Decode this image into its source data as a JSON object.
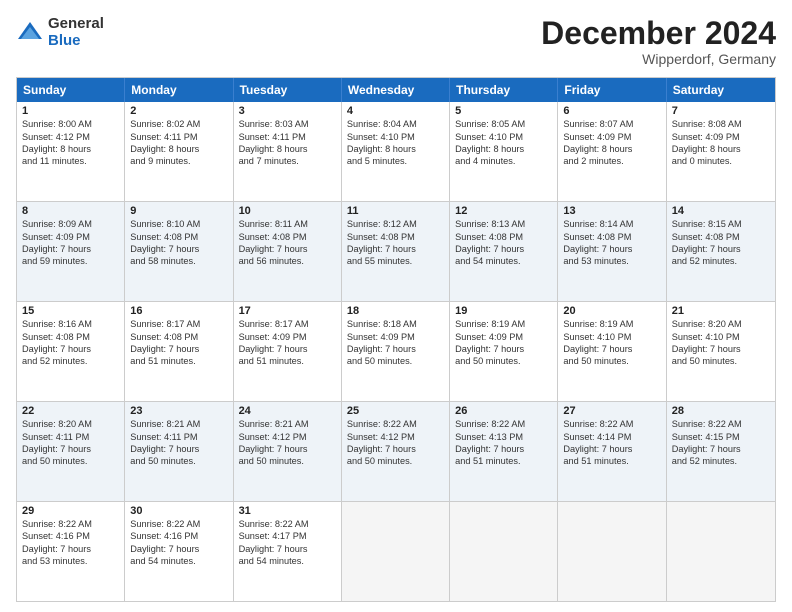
{
  "header": {
    "logo_general": "General",
    "logo_blue": "Blue",
    "month_title": "December 2024",
    "location": "Wipperdorf, Germany"
  },
  "days_of_week": [
    "Sunday",
    "Monday",
    "Tuesday",
    "Wednesday",
    "Thursday",
    "Friday",
    "Saturday"
  ],
  "rows": [
    {
      "alt": false,
      "cells": [
        {
          "day": "1",
          "lines": [
            "Sunrise: 8:00 AM",
            "Sunset: 4:12 PM",
            "Daylight: 8 hours",
            "and 11 minutes."
          ]
        },
        {
          "day": "2",
          "lines": [
            "Sunrise: 8:02 AM",
            "Sunset: 4:11 PM",
            "Daylight: 8 hours",
            "and 9 minutes."
          ]
        },
        {
          "day": "3",
          "lines": [
            "Sunrise: 8:03 AM",
            "Sunset: 4:11 PM",
            "Daylight: 8 hours",
            "and 7 minutes."
          ]
        },
        {
          "day": "4",
          "lines": [
            "Sunrise: 8:04 AM",
            "Sunset: 4:10 PM",
            "Daylight: 8 hours",
            "and 5 minutes."
          ]
        },
        {
          "day": "5",
          "lines": [
            "Sunrise: 8:05 AM",
            "Sunset: 4:10 PM",
            "Daylight: 8 hours",
            "and 4 minutes."
          ]
        },
        {
          "day": "6",
          "lines": [
            "Sunrise: 8:07 AM",
            "Sunset: 4:09 PM",
            "Daylight: 8 hours",
            "and 2 minutes."
          ]
        },
        {
          "day": "7",
          "lines": [
            "Sunrise: 8:08 AM",
            "Sunset: 4:09 PM",
            "Daylight: 8 hours",
            "and 0 minutes."
          ]
        }
      ]
    },
    {
      "alt": true,
      "cells": [
        {
          "day": "8",
          "lines": [
            "Sunrise: 8:09 AM",
            "Sunset: 4:09 PM",
            "Daylight: 7 hours",
            "and 59 minutes."
          ]
        },
        {
          "day": "9",
          "lines": [
            "Sunrise: 8:10 AM",
            "Sunset: 4:08 PM",
            "Daylight: 7 hours",
            "and 58 minutes."
          ]
        },
        {
          "day": "10",
          "lines": [
            "Sunrise: 8:11 AM",
            "Sunset: 4:08 PM",
            "Daylight: 7 hours",
            "and 56 minutes."
          ]
        },
        {
          "day": "11",
          "lines": [
            "Sunrise: 8:12 AM",
            "Sunset: 4:08 PM",
            "Daylight: 7 hours",
            "and 55 minutes."
          ]
        },
        {
          "day": "12",
          "lines": [
            "Sunrise: 8:13 AM",
            "Sunset: 4:08 PM",
            "Daylight: 7 hours",
            "and 54 minutes."
          ]
        },
        {
          "day": "13",
          "lines": [
            "Sunrise: 8:14 AM",
            "Sunset: 4:08 PM",
            "Daylight: 7 hours",
            "and 53 minutes."
          ]
        },
        {
          "day": "14",
          "lines": [
            "Sunrise: 8:15 AM",
            "Sunset: 4:08 PM",
            "Daylight: 7 hours",
            "and 52 minutes."
          ]
        }
      ]
    },
    {
      "alt": false,
      "cells": [
        {
          "day": "15",
          "lines": [
            "Sunrise: 8:16 AM",
            "Sunset: 4:08 PM",
            "Daylight: 7 hours",
            "and 52 minutes."
          ]
        },
        {
          "day": "16",
          "lines": [
            "Sunrise: 8:17 AM",
            "Sunset: 4:08 PM",
            "Daylight: 7 hours",
            "and 51 minutes."
          ]
        },
        {
          "day": "17",
          "lines": [
            "Sunrise: 8:17 AM",
            "Sunset: 4:09 PM",
            "Daylight: 7 hours",
            "and 51 minutes."
          ]
        },
        {
          "day": "18",
          "lines": [
            "Sunrise: 8:18 AM",
            "Sunset: 4:09 PM",
            "Daylight: 7 hours",
            "and 50 minutes."
          ]
        },
        {
          "day": "19",
          "lines": [
            "Sunrise: 8:19 AM",
            "Sunset: 4:09 PM",
            "Daylight: 7 hours",
            "and 50 minutes."
          ]
        },
        {
          "day": "20",
          "lines": [
            "Sunrise: 8:19 AM",
            "Sunset: 4:10 PM",
            "Daylight: 7 hours",
            "and 50 minutes."
          ]
        },
        {
          "day": "21",
          "lines": [
            "Sunrise: 8:20 AM",
            "Sunset: 4:10 PM",
            "Daylight: 7 hours",
            "and 50 minutes."
          ]
        }
      ]
    },
    {
      "alt": true,
      "cells": [
        {
          "day": "22",
          "lines": [
            "Sunrise: 8:20 AM",
            "Sunset: 4:11 PM",
            "Daylight: 7 hours",
            "and 50 minutes."
          ]
        },
        {
          "day": "23",
          "lines": [
            "Sunrise: 8:21 AM",
            "Sunset: 4:11 PM",
            "Daylight: 7 hours",
            "and 50 minutes."
          ]
        },
        {
          "day": "24",
          "lines": [
            "Sunrise: 8:21 AM",
            "Sunset: 4:12 PM",
            "Daylight: 7 hours",
            "and 50 minutes."
          ]
        },
        {
          "day": "25",
          "lines": [
            "Sunrise: 8:22 AM",
            "Sunset: 4:12 PM",
            "Daylight: 7 hours",
            "and 50 minutes."
          ]
        },
        {
          "day": "26",
          "lines": [
            "Sunrise: 8:22 AM",
            "Sunset: 4:13 PM",
            "Daylight: 7 hours",
            "and 51 minutes."
          ]
        },
        {
          "day": "27",
          "lines": [
            "Sunrise: 8:22 AM",
            "Sunset: 4:14 PM",
            "Daylight: 7 hours",
            "and 51 minutes."
          ]
        },
        {
          "day": "28",
          "lines": [
            "Sunrise: 8:22 AM",
            "Sunset: 4:15 PM",
            "Daylight: 7 hours",
            "and 52 minutes."
          ]
        }
      ]
    },
    {
      "alt": false,
      "cells": [
        {
          "day": "29",
          "lines": [
            "Sunrise: 8:22 AM",
            "Sunset: 4:16 PM",
            "Daylight: 7 hours",
            "and 53 minutes."
          ]
        },
        {
          "day": "30",
          "lines": [
            "Sunrise: 8:22 AM",
            "Sunset: 4:16 PM",
            "Daylight: 7 hours",
            "and 54 minutes."
          ]
        },
        {
          "day": "31",
          "lines": [
            "Sunrise: 8:22 AM",
            "Sunset: 4:17 PM",
            "Daylight: 7 hours",
            "and 54 minutes."
          ]
        },
        {
          "day": "",
          "lines": []
        },
        {
          "day": "",
          "lines": []
        },
        {
          "day": "",
          "lines": []
        },
        {
          "day": "",
          "lines": []
        }
      ]
    }
  ]
}
